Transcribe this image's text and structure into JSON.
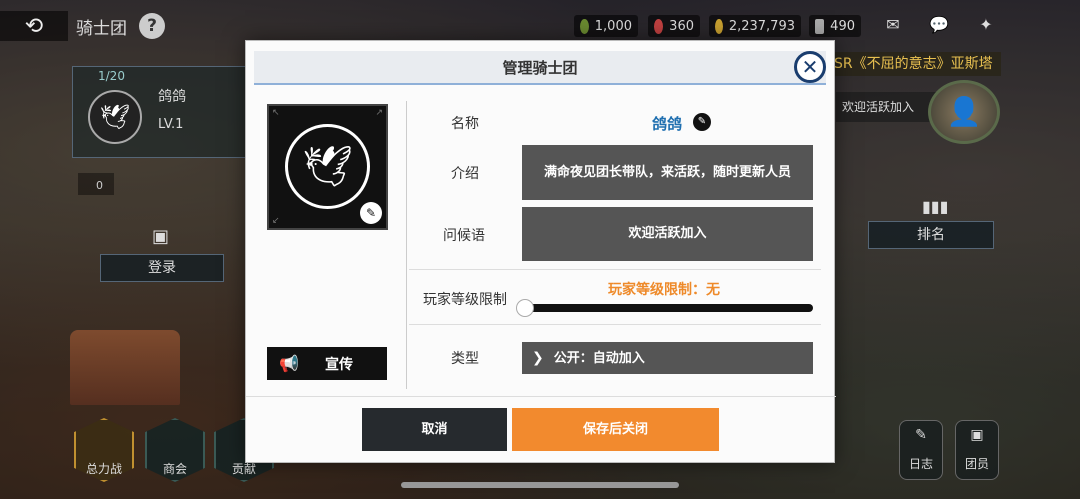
{
  "topbar": {
    "back_icon": "back-arrow-icon",
    "title": "骑士团",
    "help": "?",
    "currencies": [
      {
        "value": "1,000",
        "color": "#6a8a30"
      },
      {
        "value": "360",
        "color": "#c04040"
      },
      {
        "value": "2,237,793",
        "color": "#c8a030"
      },
      {
        "value": "490",
        "color": "#aaaaaa"
      }
    ],
    "icons": [
      "mail-icon",
      "chat-icon",
      "settings-icon"
    ],
    "notice": "SR《不屈的意志》亚斯塔"
  },
  "guild_card": {
    "count": "1/20",
    "name": "鸽鸽",
    "level": "LV.1",
    "sub_value": "0"
  },
  "left": {
    "login_label": "登录"
  },
  "bottom_nav": [
    "总力战",
    "商会",
    "贡献"
  ],
  "right": {
    "greeting": "欢迎活跃加入",
    "rank_label": "排名",
    "log_label": "日志",
    "members_label": "团员"
  },
  "dialog": {
    "title": "管理骑士团",
    "promote_label": "宣传",
    "name_label": "名称",
    "name_value": "鸽鸽",
    "intro_label": "介绍",
    "intro_value": "满命夜见团长带队，来活跃，随时更新人员",
    "greeting_label": "问候语",
    "greeting_value": "欢迎活跃加入",
    "level_label": "玩家等级限制",
    "level_value_text": "玩家等级限制：无",
    "level_fraction": 0,
    "type_label": "类型",
    "type_value": "公开：自动加入",
    "cancel": "取消",
    "save": "保存后关闭"
  }
}
